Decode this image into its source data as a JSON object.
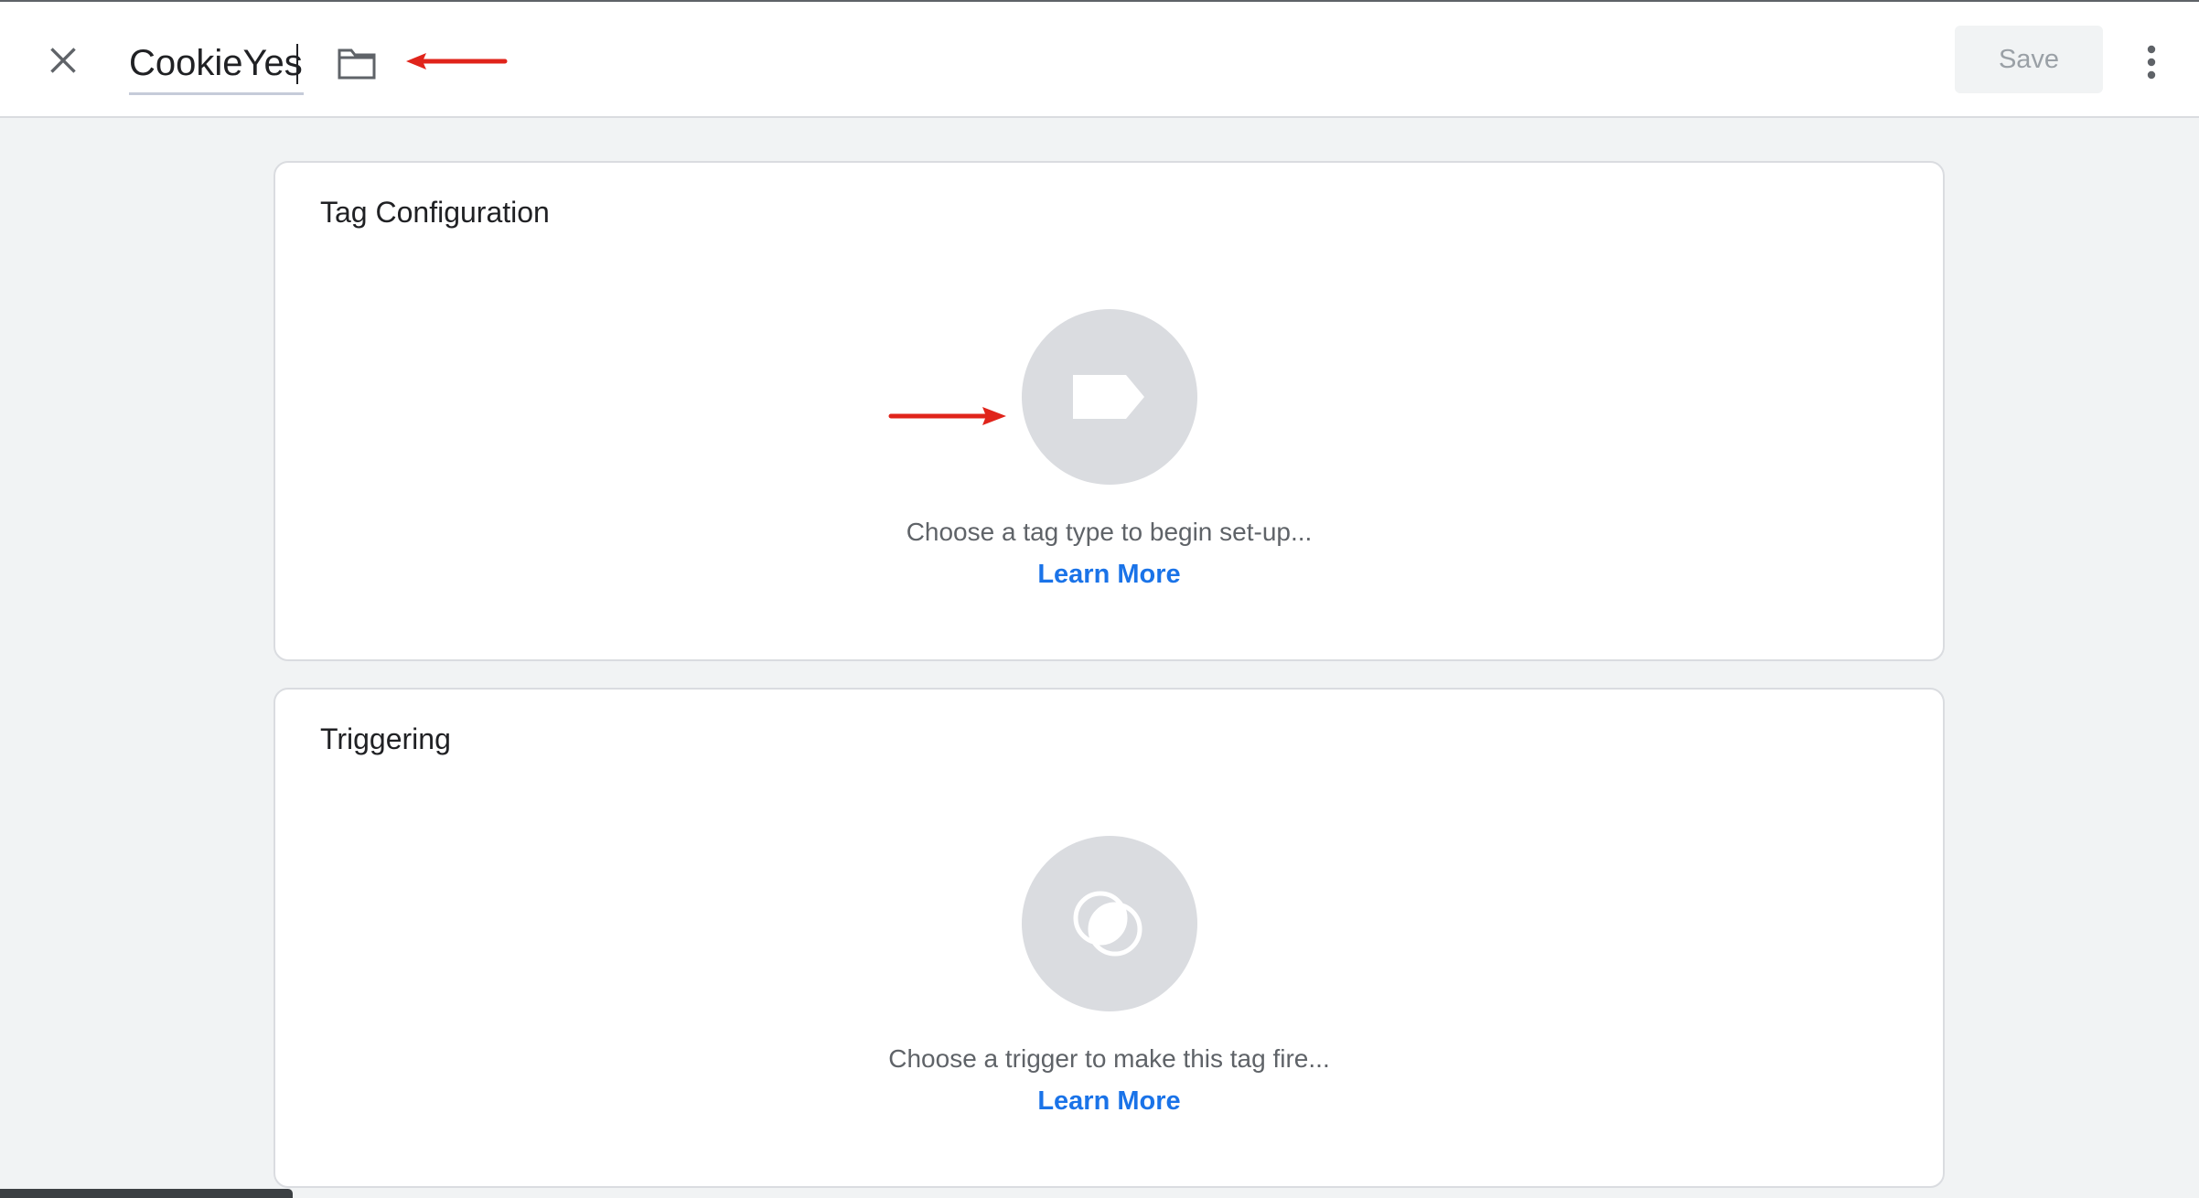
{
  "header": {
    "title_value": "CookieYes",
    "save_label": "Save",
    "icons": {
      "close": "close-icon",
      "folder": "folder-icon",
      "more": "more-vertical-icon"
    }
  },
  "tag_configuration": {
    "title": "Tag Configuration",
    "icon": "tag-icon",
    "hint": "Choose a tag type to begin set-up...",
    "learn_more": "Learn More"
  },
  "triggering": {
    "title": "Triggering",
    "icon": "trigger-icon",
    "hint": "Choose a trigger to make this tag fire...",
    "learn_more": "Learn More"
  },
  "colors": {
    "background": "#f1f3f4",
    "card": "#ffffff",
    "link": "#1a73e8",
    "annotation_arrow": "#e0241b",
    "icon_circle": "#dadce0"
  }
}
